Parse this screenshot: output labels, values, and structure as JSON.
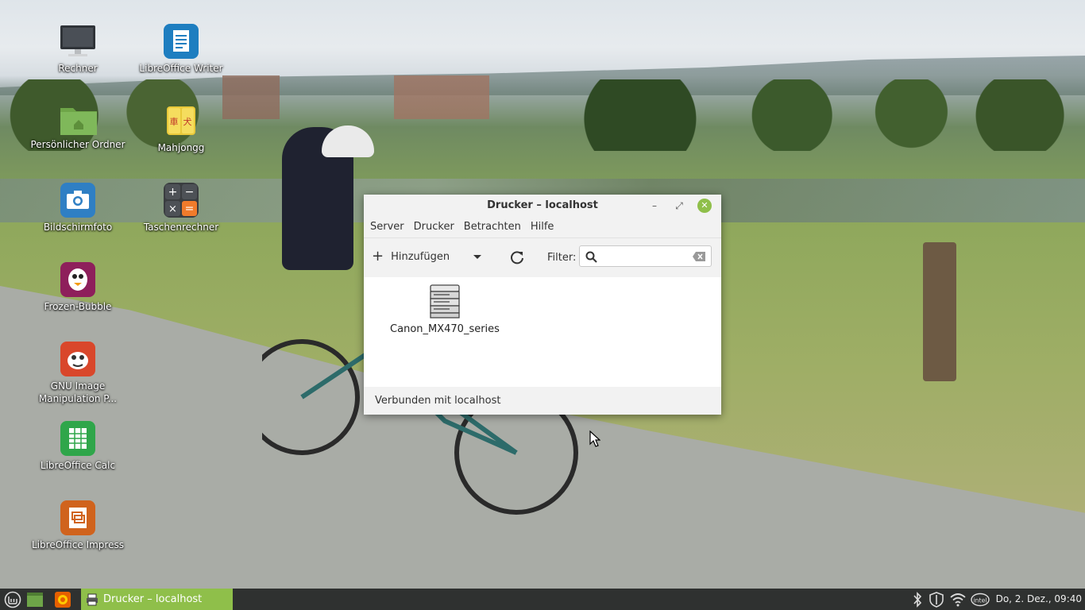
{
  "desktop": {
    "icons": [
      {
        "label": "Rechner"
      },
      {
        "label": "LibreOffice Writer"
      },
      {
        "label": "Persönlicher Ordner"
      },
      {
        "label": "Mahjongg"
      },
      {
        "label": "Bildschirmfoto"
      },
      {
        "label": "Taschenrechner"
      },
      {
        "label": "Frozen-Bubble"
      },
      {
        "label": "GNU Image Manipulation P..."
      },
      {
        "label": "LibreOffice Calc"
      },
      {
        "label": "LibreOffice Impress"
      }
    ]
  },
  "window": {
    "title": "Drucker – localhost",
    "menu": [
      "Server",
      "Drucker",
      "Betrachten",
      "Hilfe"
    ],
    "toolbar": {
      "add_label": "Hinzufügen",
      "filter_label": "Filter:",
      "filter_value": "",
      "filter_placeholder": ""
    },
    "printers": [
      {
        "name": "Canon_MX470_series"
      }
    ],
    "status": "Verbunden mit localhost"
  },
  "taskbar": {
    "task_label": "Drucker – localhost",
    "clock": "Do, 2. Dez., 09:40",
    "accent": "#8fbf4a"
  }
}
